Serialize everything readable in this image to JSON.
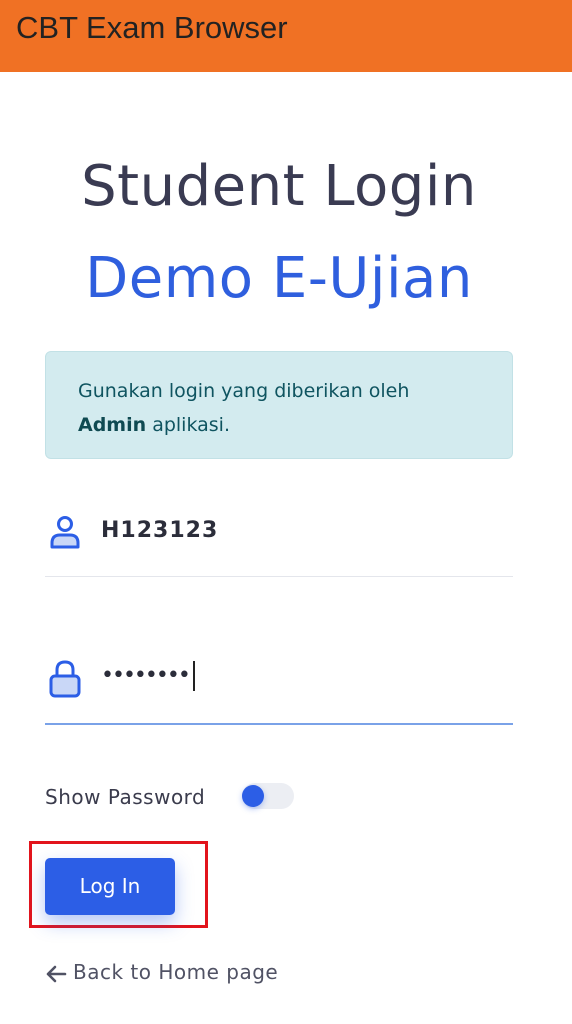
{
  "appbar": {
    "title": "CBT Exam Browser",
    "color": "#f07124"
  },
  "header": {
    "title_line1": "Student Login",
    "title_line2": "Demo E-Ujian"
  },
  "notice": {
    "text_before": "Gunakan login yang diberikan oleh",
    "text_bold": "Admin",
    "text_after": " aplikasi."
  },
  "form": {
    "username_value": "H123123",
    "username_icon": "user-icon",
    "password_masked": "••••••••",
    "password_icon": "lock-icon",
    "show_password_label": "Show Password",
    "show_password_on": false,
    "login_label": "Log In",
    "back_label": "Back to Home page",
    "back_icon": "arrow-left-icon"
  },
  "colors": {
    "accent": "#2c5ee6",
    "heading": "#3a3b52",
    "notice_bg": "#d3ebef",
    "highlight": "#e2141c"
  }
}
